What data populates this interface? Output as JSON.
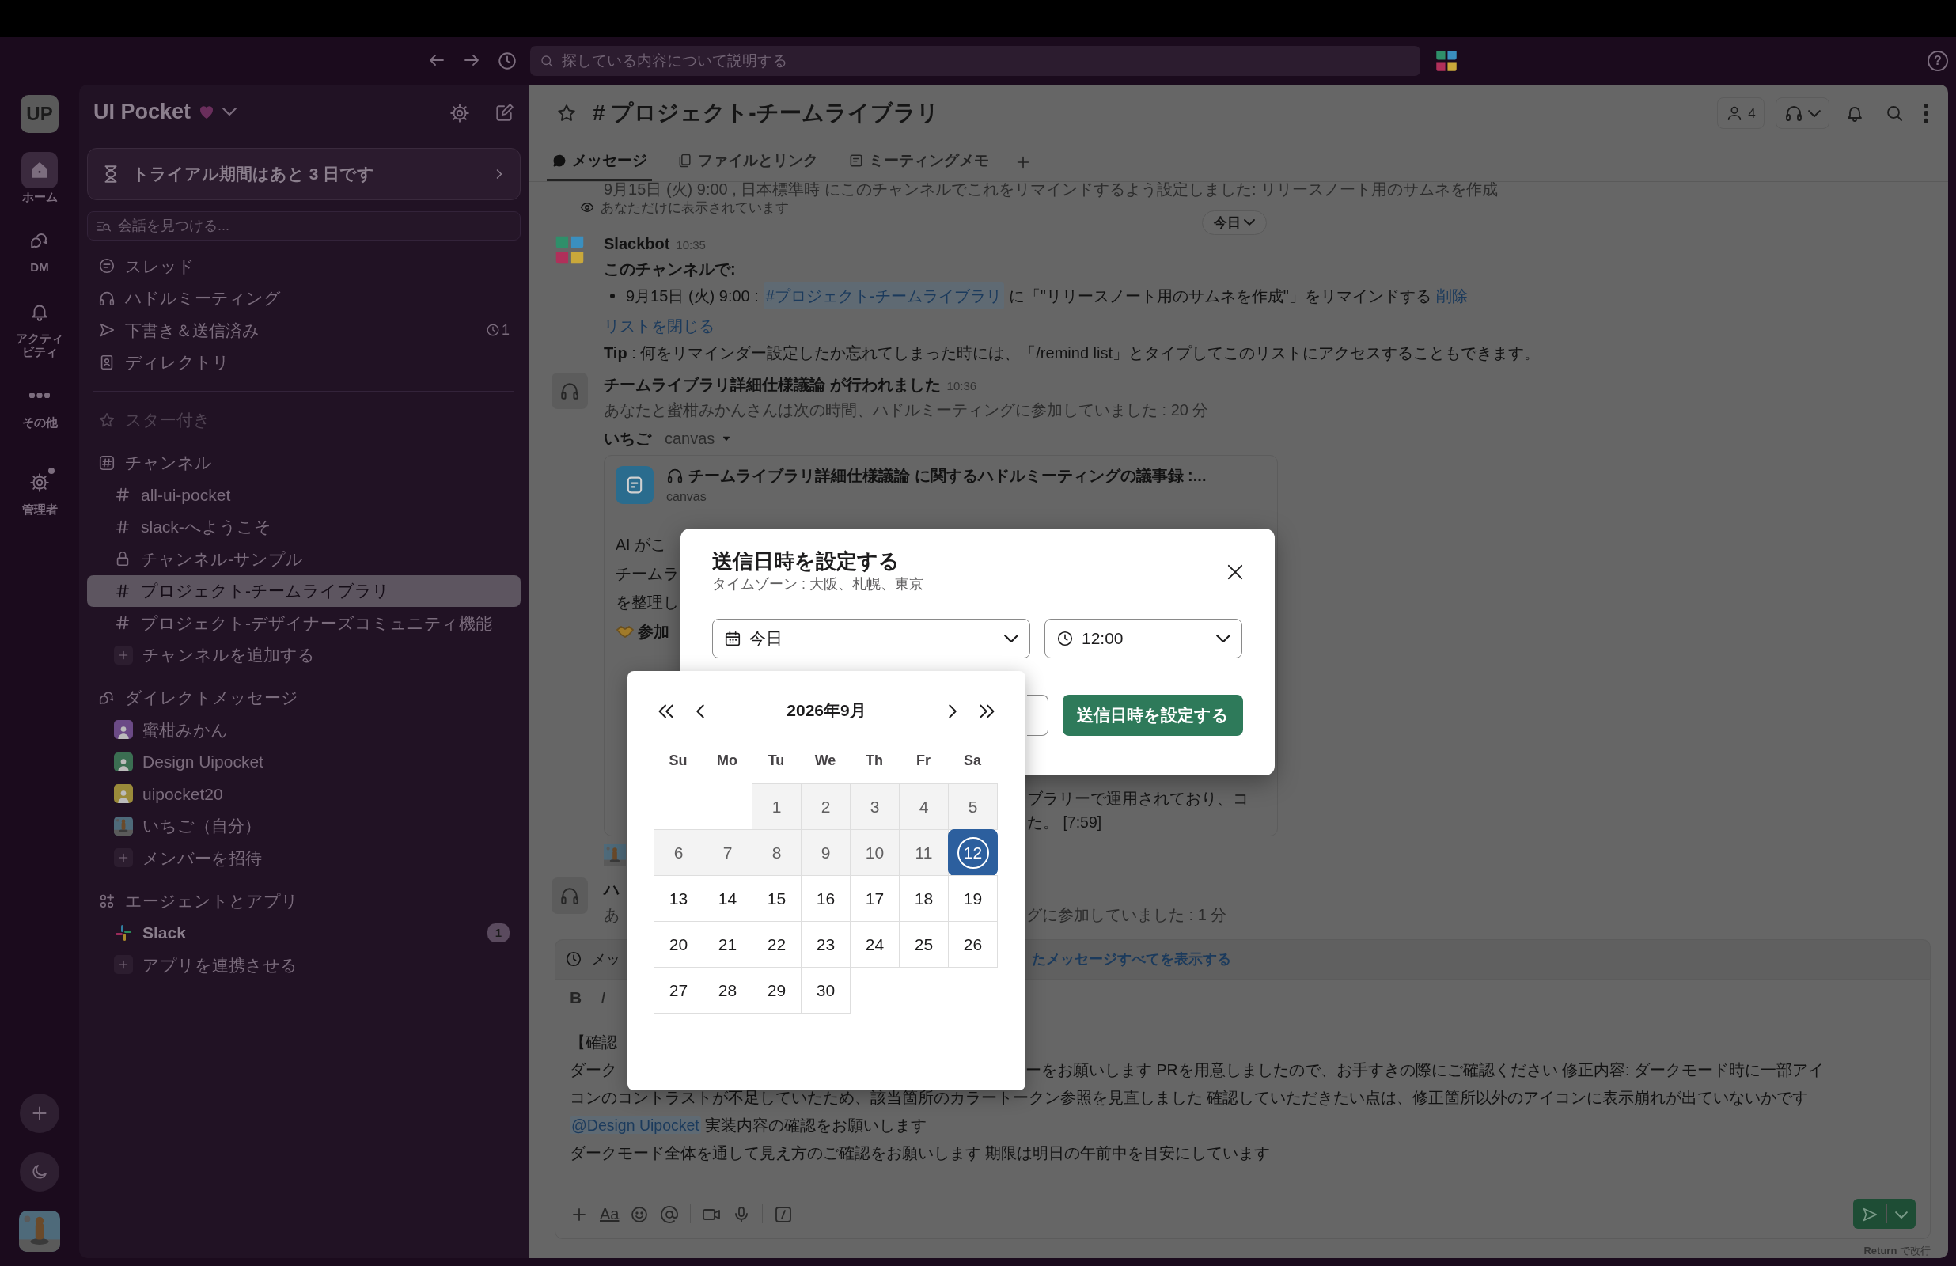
{
  "toolbar": {
    "search_placeholder": "探している内容について説明する",
    "help": "?"
  },
  "rail": [
    {
      "label": "ホーム",
      "kind": "home",
      "selected": true,
      "dot": false
    },
    {
      "label": "DM",
      "kind": "dm",
      "selected": false,
      "dot": false
    },
    {
      "label": "アクティビティ",
      "kind": "activity",
      "selected": false,
      "dot": false
    },
    {
      "label": "その他",
      "kind": "more",
      "selected": false,
      "dot": false
    },
    {
      "label": "管理者",
      "kind": "admin",
      "selected": false,
      "dot": true
    }
  ],
  "workspace": {
    "logo": "UP",
    "name": "UI Pocket"
  },
  "trial_banner": "トライアル期間はあと 3 日です",
  "sidebar_search": {
    "placeholder": "会話を見つける..."
  },
  "nav_items": [
    {
      "label": "スレッド",
      "kind": "threads"
    },
    {
      "label": "ハドルミーティング",
      "kind": "huddles"
    },
    {
      "label": "下書き＆送信済み",
      "kind": "drafts",
      "scheduled_count": "1"
    },
    {
      "label": "ディレクトリ",
      "kind": "directory"
    }
  ],
  "sections": [
    {
      "title": "スター付き",
      "kind": "starred"
    },
    {
      "title": "チャンネル",
      "kind": "channels",
      "items": [
        {
          "label": "all-ui-pocket",
          "kind": "public",
          "selected": false,
          "unread": false
        },
        {
          "label": "slack-へようこそ",
          "kind": "public",
          "selected": false,
          "unread": false
        },
        {
          "label": "チャンネル-サンプル",
          "kind": "private",
          "selected": false,
          "unread": false
        },
        {
          "label": "プロジェクト-チームライブラリ",
          "kind": "public",
          "selected": true,
          "unread": false
        },
        {
          "label": "プロジェクト-デザイナーズコミュニティ機能",
          "kind": "public",
          "selected": false,
          "unread": false
        },
        {
          "label": "チャンネルを追加する",
          "kind": "add",
          "selected": false,
          "unread": false
        }
      ]
    },
    {
      "title": "ダイレクトメッセージ",
      "kind": "dms",
      "items": [
        {
          "label": "蜜柑みかん",
          "kind": "user",
          "color": "#6b4a86",
          "selected": false,
          "unread": false
        },
        {
          "label": "Design Uipocket",
          "kind": "user",
          "color": "#3b6e52",
          "selected": false,
          "unread": false
        },
        {
          "label": "uipocket20",
          "kind": "user",
          "color": "#9a8a3a",
          "selected": false,
          "unread": false
        },
        {
          "label": "いちご（自分）",
          "kind": "self",
          "selected": false,
          "unread": false
        },
        {
          "label": "メンバーを招待",
          "kind": "add",
          "selected": false,
          "unread": false
        }
      ]
    },
    {
      "title": "エージェントとアプリ",
      "kind": "apps",
      "items": [
        {
          "label": "Slack",
          "kind": "app",
          "selected": false,
          "unread": true,
          "badge": "1"
        },
        {
          "label": "アプリを連携させる",
          "kind": "add",
          "selected": false,
          "unread": false
        }
      ]
    }
  ],
  "channel": {
    "title": "# プロジェクト-チームライブラリ",
    "member_count": "4"
  },
  "tabs": [
    {
      "label": "メッセージ",
      "kind": "messages",
      "selected": true
    },
    {
      "label": "ファイルとリンク",
      "kind": "files",
      "selected": false
    },
    {
      "label": "ミーティングメモ",
      "kind": "notes",
      "selected": false
    }
  ],
  "date_pill": "今日",
  "messages": [
    {
      "kind": "cut",
      "text": "9月15日 (火) 9:00 , 日本標準時 にこのチャンネルでこれをリマインドするよう設定しました: リリースノート用のサムネを作成"
    },
    {
      "kind": "ephemeral",
      "text": "あなただけに表示されています"
    },
    {
      "kind": "bot",
      "author": "Slackbot",
      "time": "10:35",
      "heading": "このチャンネルで:",
      "bullet": {
        "date": "9月15日 (火) 9:00 :",
        "channel": "#プロジェクト-チームライブラリ",
        "text": "に「\"リリースノート用のサムネを作成\"」をリマインドする",
        "action": "削除"
      },
      "link": "リストを閉じる",
      "tip": "**Tip** : 何をリマインダー設定したか忘れてしまった時には、「/remind list」とタイプしてこのリストにアクセスすることもできます。"
    },
    {
      "kind": "huddle",
      "title": "チームライブラリ詳細仕様議論 が行われました",
      "time": "10:36",
      "text": "あなたと蜜柑みかんさんは次の時間、ハドルミーティングに参加していました : 20 分",
      "author": "いちご",
      "source": "canvas",
      "card": {
        "title": "チームライブラリ詳細仕様議論 に関するハドルミーティングの議事録 :...",
        "type": "canvas",
        "left_lines": [
          "AI がこ",
          "チームラ",
          "を整理し",
          "参加"
        ],
        "right_lines": [
          "ブラリーで運用されており、コ",
          "た。 [7:59]"
        ]
      }
    },
    {
      "kind": "huddle_cut",
      "title": "ハ",
      "left": "あ",
      "right": "グに参加していました : 1 分"
    }
  ],
  "notice": {
    "left": "メッ",
    "link": "たメッセージすべてを表示する"
  },
  "composer": {
    "format_buttons": [
      "B",
      "I"
    ],
    "lines": [
      {
        "kind": "split",
        "left": "【確認"
      },
      {
        "kind": "split",
        "left": "ダーク",
        "right": "ーをお願いします PRを用意しましたので、お手すきの際にご確認ください 修正内容: ダークモード時に一部アイ"
      },
      {
        "kind": "plain",
        "text": "コンのコントラストが不足していたため、該当箇所のカラートークン参照を見直しました 確認していただきたい点は、修正箇所以外のアイコンに表示崩れが出ていないかです"
      },
      {
        "kind": "mention",
        "mention": "@Design Uipocket",
        "text": "実装内容の確認をお願いします"
      },
      {
        "kind": "plain",
        "text": "ダークモード全体を通して見え方のご確認をお願いします 期限は明日の午前中を目安にしています"
      }
    ],
    "text_style": "Aa",
    "hint": "**Return** で改行"
  },
  "modal": {
    "title": "送信日時を設定する",
    "subtitle": "タイムゾーン : 大阪、札幌、東京",
    "date_value": "今日",
    "time_value": "12:00",
    "submit": "送信日時を設定する"
  },
  "calendar": {
    "month": "2026年9月",
    "weekdays": [
      "Su",
      "Mo",
      "Tu",
      "We",
      "Th",
      "Fr",
      "Sa"
    ],
    "days": [
      {
        "kind": "blank"
      },
      {
        "kind": "blank"
      },
      {
        "kind": "day",
        "label": "1",
        "disabled": true,
        "selected": false
      },
      {
        "kind": "day",
        "label": "2",
        "disabled": true,
        "selected": false
      },
      {
        "kind": "day",
        "label": "3",
        "disabled": true,
        "selected": false
      },
      {
        "kind": "day",
        "label": "4",
        "disabled": true,
        "selected": false
      },
      {
        "kind": "day",
        "label": "5",
        "disabled": true,
        "selected": false
      },
      {
        "kind": "day",
        "label": "6",
        "disabled": true,
        "selected": false
      },
      {
        "kind": "day",
        "label": "7",
        "disabled": true,
        "selected": false
      },
      {
        "kind": "day",
        "label": "8",
        "disabled": true,
        "selected": false
      },
      {
        "kind": "day",
        "label": "9",
        "disabled": true,
        "selected": false
      },
      {
        "kind": "day",
        "label": "10",
        "disabled": true,
        "selected": false
      },
      {
        "kind": "day",
        "label": "11",
        "disabled": true,
        "selected": false
      },
      {
        "kind": "day",
        "label": "12",
        "disabled": false,
        "selected": true
      },
      {
        "kind": "day",
        "label": "13",
        "disabled": false,
        "selected": false
      },
      {
        "kind": "day",
        "label": "14",
        "disabled": false,
        "selected": false
      },
      {
        "kind": "day",
        "label": "15",
        "disabled": false,
        "selected": false
      },
      {
        "kind": "day",
        "label": "16",
        "disabled": false,
        "selected": false
      },
      {
        "kind": "day",
        "label": "17",
        "disabled": false,
        "selected": false
      },
      {
        "kind": "day",
        "label": "18",
        "disabled": false,
        "selected": false
      },
      {
        "kind": "day",
        "label": "19",
        "disabled": false,
        "selected": false
      },
      {
        "kind": "day",
        "label": "20",
        "disabled": false,
        "selected": false
      },
      {
        "kind": "day",
        "label": "21",
        "disabled": false,
        "selected": false
      },
      {
        "kind": "day",
        "label": "22",
        "disabled": false,
        "selected": false
      },
      {
        "kind": "day",
        "label": "23",
        "disabled": false,
        "selected": false
      },
      {
        "kind": "day",
        "label": "24",
        "disabled": false,
        "selected": false
      },
      {
        "kind": "day",
        "label": "25",
        "disabled": false,
        "selected": false
      },
      {
        "kind": "day",
        "label": "26",
        "disabled": false,
        "selected": false
      },
      {
        "kind": "day",
        "label": "27",
        "disabled": false,
        "selected": false
      },
      {
        "kind": "day",
        "label": "28",
        "disabled": false,
        "selected": false
      },
      {
        "kind": "day",
        "label": "29",
        "disabled": false,
        "selected": false
      },
      {
        "kind": "day",
        "label": "30",
        "disabled": false,
        "selected": false
      }
    ]
  }
}
